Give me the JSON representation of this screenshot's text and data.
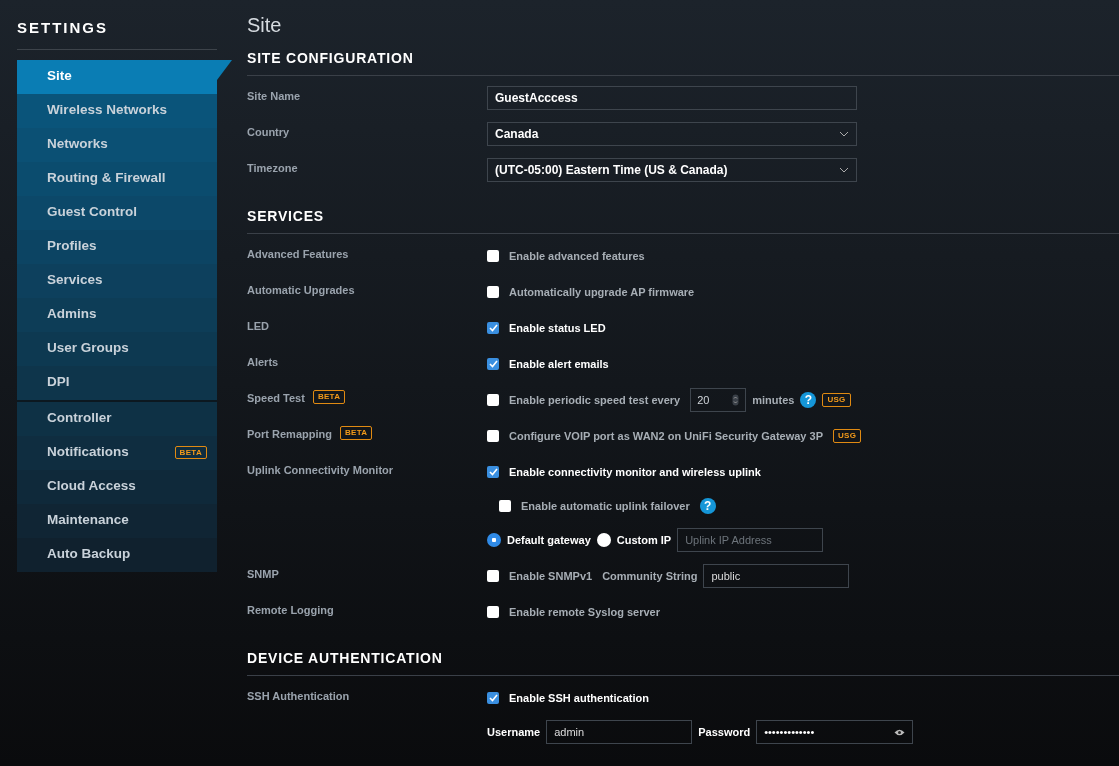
{
  "sidebar": {
    "title": "SETTINGS",
    "groups": [
      {
        "items": [
          {
            "label": "Site",
            "selected": true
          },
          {
            "label": "Wireless Networks",
            "selected": false
          },
          {
            "label": "Networks",
            "selected": false
          },
          {
            "label": "Routing & Firewall",
            "selected": false
          },
          {
            "label": "Guest Control",
            "selected": false
          },
          {
            "label": "Profiles",
            "selected": false
          },
          {
            "label": "Services",
            "selected": false
          },
          {
            "label": "Admins",
            "selected": false
          },
          {
            "label": "User Groups",
            "selected": false
          },
          {
            "label": "DPI",
            "selected": false
          }
        ]
      },
      {
        "items": [
          {
            "label": "Controller",
            "selected": false
          },
          {
            "label": "Notifications",
            "badge": "BETA",
            "selected": false
          },
          {
            "label": "Cloud Access",
            "selected": false
          },
          {
            "label": "Maintenance",
            "selected": false
          },
          {
            "label": "Auto Backup",
            "selected": false
          }
        ]
      }
    ]
  },
  "page_title": "Site",
  "sections": [
    {
      "title": "SITE CONFIGURATION",
      "rows": [
        {
          "label": "Site Name",
          "lines": [
            {
              "items": [
                {
                  "kind": "input",
                  "value": "GuestAcccess"
                }
              ]
            }
          ]
        },
        {
          "label": "Country",
          "lines": [
            {
              "items": [
                {
                  "kind": "select",
                  "value": "Canada"
                }
              ]
            }
          ]
        },
        {
          "label": "Timezone",
          "lines": [
            {
              "items": [
                {
                  "kind": "select",
                  "value": "(UTC-05:00) Eastern Time (US & Canada)"
                }
              ]
            }
          ]
        }
      ]
    },
    {
      "title": "SERVICES",
      "rows": [
        {
          "label": "Advanced Features",
          "lines": [
            {
              "items": [
                {
                  "kind": "check",
                  "label": "Enable advanced features",
                  "checked": false
                }
              ]
            }
          ]
        },
        {
          "label": "Automatic Upgrades",
          "lines": [
            {
              "items": [
                {
                  "kind": "check",
                  "label": "Automatically upgrade AP firmware",
                  "checked": false
                }
              ]
            }
          ]
        },
        {
          "label": "LED",
          "lines": [
            {
              "items": [
                {
                  "kind": "check",
                  "label": "Enable status LED",
                  "checked": true
                }
              ]
            }
          ]
        },
        {
          "label": "Alerts",
          "lines": [
            {
              "items": [
                {
                  "kind": "check",
                  "label": "Enable alert emails",
                  "checked": true
                }
              ]
            }
          ]
        },
        {
          "label": "Speed Test",
          "badge": "BETA",
          "lines": [
            {
              "items": [
                {
                  "kind": "check",
                  "label": "Enable periodic speed test every",
                  "checked": false
                },
                {
                  "kind": "number",
                  "value": "20"
                },
                {
                  "kind": "text",
                  "text": "minutes"
                },
                {
                  "kind": "help",
                  "text": "?"
                },
                {
                  "kind": "tag",
                  "text": "USG"
                }
              ]
            }
          ]
        },
        {
          "label": "Port Remapping",
          "badge": "BETA",
          "lines": [
            {
              "items": [
                {
                  "kind": "check",
                  "label": "Configure VOIP port as WAN2 on UniFi Security Gateway 3P",
                  "checked": false
                },
                {
                  "kind": "tag",
                  "text": "USG"
                }
              ]
            }
          ]
        },
        {
          "label": "Uplink Connectivity Monitor",
          "lines": [
            {
              "items": [
                {
                  "kind": "check",
                  "label": "Enable connectivity monitor and wireless uplink",
                  "checked": true
                }
              ]
            },
            {
              "indent": true,
              "items": [
                {
                  "kind": "check",
                  "label": "Enable automatic uplink failover",
                  "checked": false
                },
                {
                  "kind": "help",
                  "text": "?"
                }
              ]
            },
            {
              "items": [
                {
                  "kind": "radio",
                  "label": "Default gateway",
                  "selected": true
                },
                {
                  "kind": "radio",
                  "label": "Custom IP",
                  "selected": false
                },
                {
                  "kind": "field",
                  "placeholder": "Uplink IP Address"
                }
              ]
            }
          ]
        },
        {
          "label": "SNMP",
          "lines": [
            {
              "items": [
                {
                  "kind": "check",
                  "label": "Enable SNMPv1",
                  "checked": false
                },
                {
                  "kind": "text",
                  "text": "Community String"
                },
                {
                  "kind": "field",
                  "value": "public"
                }
              ]
            }
          ]
        },
        {
          "label": "Remote Logging",
          "lines": [
            {
              "items": [
                {
                  "kind": "check",
                  "label": "Enable remote Syslog server",
                  "checked": false
                }
              ]
            }
          ]
        }
      ]
    },
    {
      "title": "DEVICE AUTHENTICATION",
      "rows": [
        {
          "label": "SSH Authentication",
          "lines": [
            {
              "items": [
                {
                  "kind": "check",
                  "label": "Enable SSH authentication",
                  "checked": true
                }
              ]
            },
            {
              "items": [
                {
                  "kind": "fieldlabel",
                  "text": "Username"
                },
                {
                  "kind": "field",
                  "value": "admin"
                },
                {
                  "kind": "fieldlabel",
                  "text": "Password"
                },
                {
                  "kind": "password",
                  "value": "•••••••••••••"
                }
              ]
            }
          ]
        }
      ]
    }
  ]
}
